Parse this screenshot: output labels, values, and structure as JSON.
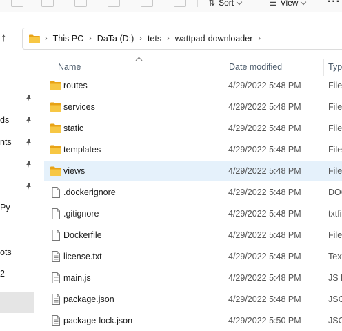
{
  "toolbar": {
    "sort_label": "Sort",
    "view_label": "View",
    "more_label": "···",
    "icons": [
      "cut-icon",
      "copy-icon",
      "paste-icon",
      "rename-icon",
      "share-icon",
      "delete-icon"
    ]
  },
  "address": {
    "up_icon": "↑",
    "crumbs": [
      "This PC",
      "DaTa (D:)",
      "tets",
      "wattpad-downloader"
    ]
  },
  "sidebar": {
    "labels": [
      "ds",
      "nts",
      "Py",
      "ots",
      "2"
    ]
  },
  "columns": {
    "name": "Name",
    "date_modified": "Date modified",
    "type": "Type"
  },
  "files": [
    {
      "name": "routes",
      "date": "4/29/2022 5:48 PM",
      "type": "File",
      "kind": "folder"
    },
    {
      "name": "services",
      "date": "4/29/2022 5:48 PM",
      "type": "File",
      "kind": "folder"
    },
    {
      "name": "static",
      "date": "4/29/2022 5:48 PM",
      "type": "File",
      "kind": "folder"
    },
    {
      "name": "templates",
      "date": "4/29/2022 5:48 PM",
      "type": "File",
      "kind": "folder"
    },
    {
      "name": "views",
      "date": "4/29/2022 5:48 PM",
      "type": "File",
      "kind": "folder"
    },
    {
      "name": ".dockerignore",
      "date": "4/29/2022 5:48 PM",
      "type": "DOC",
      "kind": "file"
    },
    {
      "name": ".gitignore",
      "date": "4/29/2022 5:48 PM",
      "type": "txtfi",
      "kind": "file"
    },
    {
      "name": "Dockerfile",
      "date": "4/29/2022 5:48 PM",
      "type": "File",
      "kind": "file"
    },
    {
      "name": "license.txt",
      "date": "4/29/2022 5:48 PM",
      "type": "Text",
      "kind": "text"
    },
    {
      "name": "main.js",
      "date": "4/29/2022 5:48 PM",
      "type": "JS F",
      "kind": "text"
    },
    {
      "name": "package.json",
      "date": "4/29/2022 5:48 PM",
      "type": "JSO",
      "kind": "text"
    },
    {
      "name": "package-lock.json",
      "date": "4/29/2022 5:50 PM",
      "type": "JSO",
      "kind": "text"
    }
  ],
  "colors": {
    "folder": "#f7c744",
    "selected_row": "#e5f1fb",
    "accent": "#0067c0"
  }
}
